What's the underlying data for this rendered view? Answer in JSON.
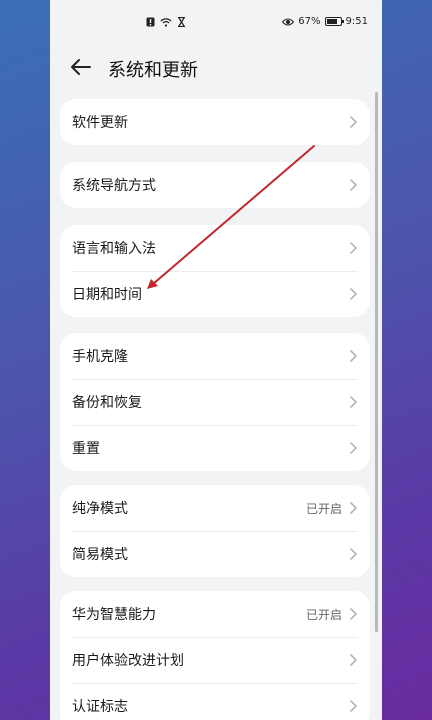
{
  "status_bar": {
    "battery": "67%",
    "time": "9:51"
  },
  "header": {
    "title": "系统和更新"
  },
  "cards": [
    {
      "rows": [
        {
          "label": "软件更新",
          "value": ""
        }
      ]
    },
    {
      "rows": [
        {
          "label": "系统导航方式",
          "value": ""
        }
      ]
    },
    {
      "rows": [
        {
          "label": "语言和输入法",
          "value": ""
        },
        {
          "label": "日期和时间",
          "value": ""
        }
      ]
    },
    {
      "rows": [
        {
          "label": "手机克隆",
          "value": ""
        },
        {
          "label": "备份和恢复",
          "value": ""
        },
        {
          "label": "重置",
          "value": ""
        }
      ]
    },
    {
      "rows": [
        {
          "label": "纯净模式",
          "value": "已开启"
        },
        {
          "label": "简易模式",
          "value": ""
        }
      ]
    },
    {
      "rows": [
        {
          "label": "华为智慧能力",
          "value": "已开启"
        },
        {
          "label": "用户体验改进计划",
          "value": ""
        },
        {
          "label": "认证标志",
          "value": ""
        }
      ]
    }
  ],
  "annotation_color": "#c0282c"
}
